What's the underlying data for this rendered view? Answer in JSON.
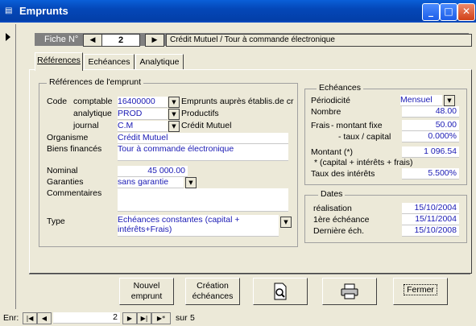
{
  "window": {
    "title": "Emprunts",
    "icon": "form-icon"
  },
  "record_nav": {
    "fiche_label": "Fiche N°",
    "fiche_number": "2",
    "description": "Crédit Mutuel / Tour à commande électronique"
  },
  "tabs": [
    {
      "label": "Références",
      "active": true
    },
    {
      "label": "Echéances",
      "active": false
    },
    {
      "label": "Analytique",
      "active": false
    }
  ],
  "references": {
    "group_title": "Références de l'emprunt",
    "code_label": "Code",
    "comptable_label": "comptable",
    "comptable_value": "16400000",
    "comptable_desc": "Emprunts auprès établis.de créd",
    "analytique_label": "analytique",
    "analytique_value": "PROD",
    "analytique_desc": "Productifs",
    "journal_label": "journal",
    "journal_value": "C.M",
    "journal_desc": "Crédit Mutuel",
    "organisme_label": "Organisme",
    "organisme_value": "Crédit Mutuel",
    "biens_label": "Biens financés",
    "biens_value": "Tour à commande électronique",
    "nominal_label": "Nominal",
    "nominal_value": "45 000.00",
    "garanties_label": "Garanties",
    "garanties_value": "sans garantie",
    "commentaires_label": "Commentaires",
    "commentaires_value": "",
    "type_label": "Type",
    "type_value_line1": "Echéances constantes (capital +",
    "type_value_line2": "intérêts+Frais)"
  },
  "echeances": {
    "group_title": "Echéances",
    "periodicite_label": "Périodicité",
    "periodicite_value": "Mensuel",
    "nombre_label": "Nombre",
    "nombre_value": "48.00",
    "frais_label": "Frais",
    "montant_fixe_label": "- montant fixe",
    "montant_fixe_value": "50.00",
    "taux_capital_label": "- taux / capital",
    "taux_capital_value": "0.000%",
    "montant_label": "Montant (*)",
    "montant_value": "1 096.54",
    "note": "* (capital + intérêts + frais)",
    "taux_interets_label": "Taux des intérêts",
    "taux_interets_value": "5.500%"
  },
  "dates": {
    "group_title": "Dates",
    "realisation_label": "réalisation",
    "realisation_value": "15/10/2004",
    "premiere_label": "1ère échéance",
    "premiere_value": "15/11/2004",
    "derniere_label": "Dernière éch.",
    "derniere_value": "15/10/2008"
  },
  "buttons": {
    "nouvel_line1": "Nouvel",
    "nouvel_line2": "emprunt",
    "creation_line1": "Création",
    "creation_line2": "échéances",
    "fermer": "Fermer"
  },
  "statusbar": {
    "enr_label": "Enr:",
    "current": "2",
    "sur_label": "sur",
    "total": "5"
  }
}
